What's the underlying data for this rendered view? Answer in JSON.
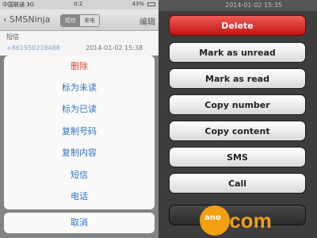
{
  "left": {
    "status": {
      "carrier": "中国联通 3G",
      "time": "0:2",
      "battery": "43%"
    },
    "nav": {
      "back": "SMSNinja",
      "seg_on": "短信",
      "seg_off": "来电",
      "edit": "编辑"
    },
    "section": "短信",
    "message": {
      "sender": "+861550218488",
      "date": "2014-01-02 15:38"
    },
    "sheet": [
      "删除",
      "标为未读",
      "标为已读",
      "复制号码",
      "复制内容",
      "短信",
      "电话"
    ],
    "cancel": "取消"
  },
  "right": {
    "top_date": "2014-01-02 15:35",
    "buttons": [
      "Delete",
      "Mark as unread",
      "Mark as read",
      "Copy number",
      "Copy content",
      "SMS",
      "Call"
    ],
    "watermark": {
      "text": ".com",
      "small": "ano"
    }
  }
}
